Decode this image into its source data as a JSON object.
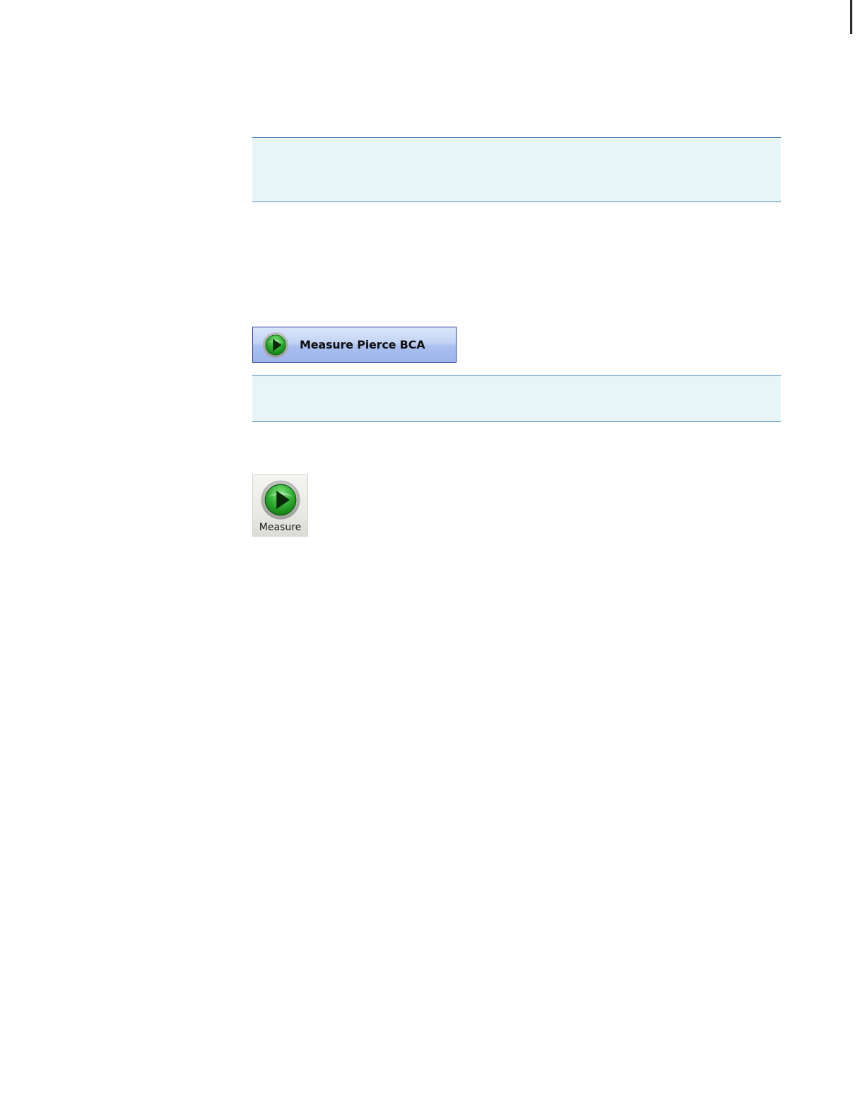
{
  "buttons": {
    "measure_pierce_bca": {
      "label": "Measure Pierce BCA",
      "icon": "play-icon"
    },
    "measure": {
      "label": "Measure",
      "icon": "play-icon"
    }
  },
  "colors": {
    "note_background": "#e8f5f8",
    "note_rule": "#4a86b8",
    "button_border": "#2f3f9a",
    "button_fill": "#b8cbf2",
    "play_green": "#2f9e2f"
  }
}
